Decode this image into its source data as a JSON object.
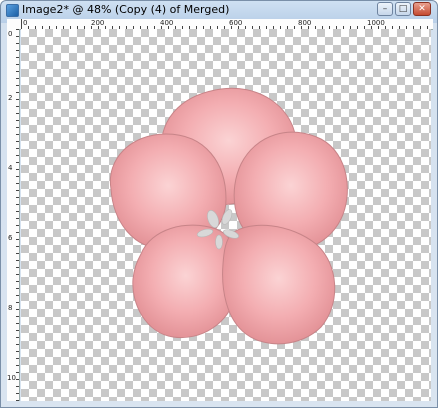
{
  "window": {
    "title": "Image2* @ 48% (Copy (4) of Merged)",
    "buttons": {
      "minimize": "–",
      "maximize": "□",
      "close": "✕"
    }
  },
  "ruler": {
    "top_labels": [
      "0",
      "200",
      "400",
      "600",
      "800",
      "1000"
    ],
    "left_labels": [
      "0",
      "2",
      "4",
      "6",
      "8",
      "10"
    ]
  },
  "canvas": {
    "background": "transparent checkerboard",
    "content": "pink five-petal flower"
  },
  "colors": {
    "petal": "#f2a8ac",
    "petal_highlight": "#fbd0d0",
    "petal_edge": "#c9868a"
  }
}
